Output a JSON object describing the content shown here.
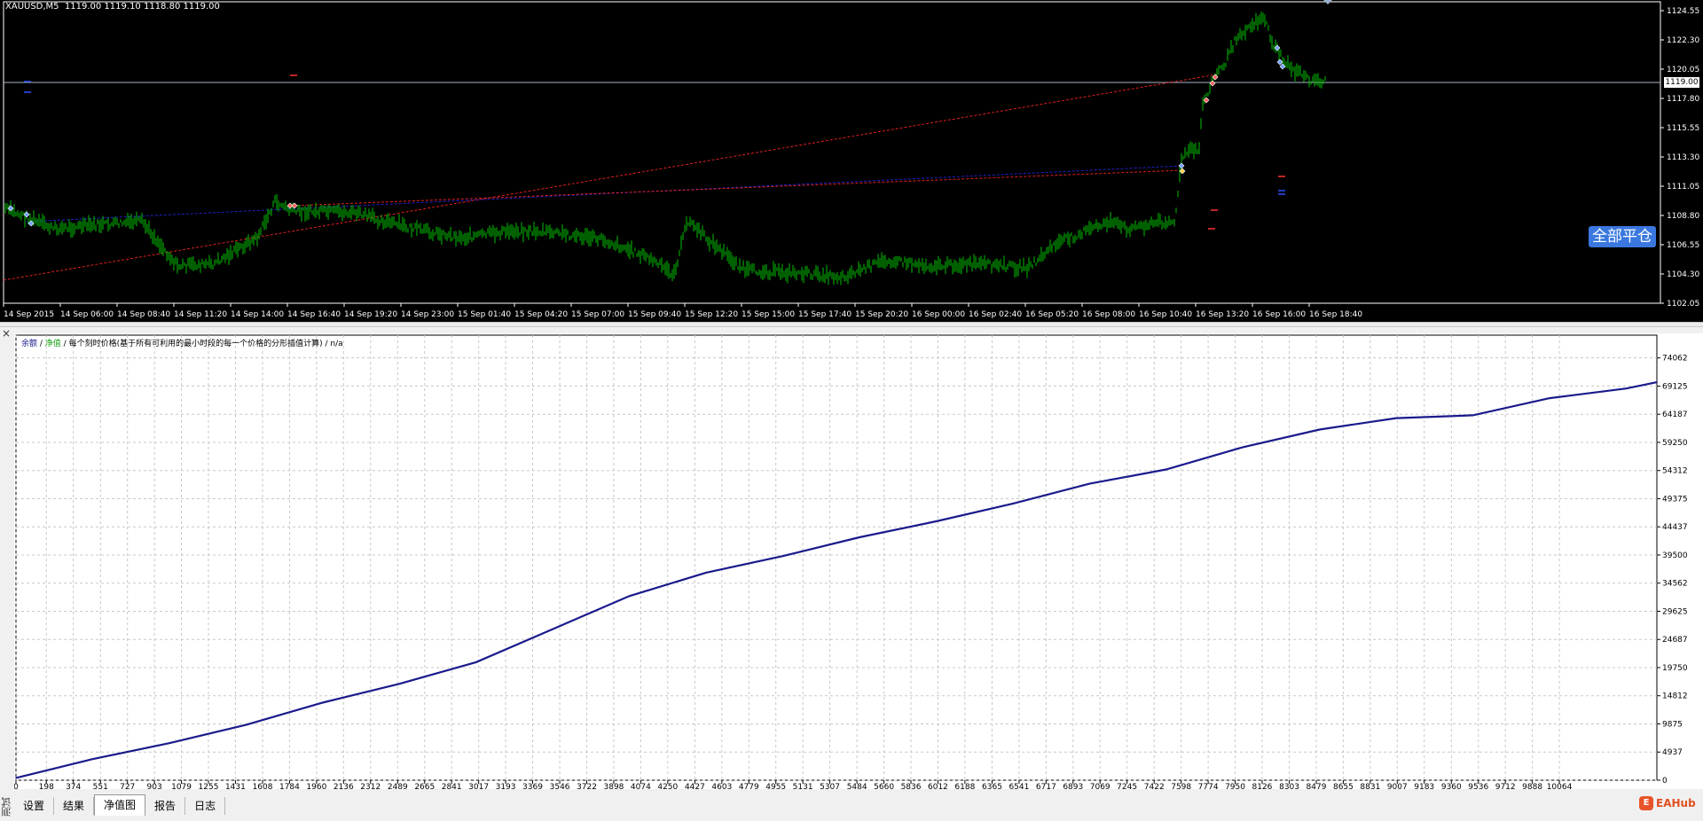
{
  "price_chart": {
    "header": "XAUUSD,M5  1119.00 1119.10 1118.80 1119.00",
    "price_axis": [
      "1124.55",
      "1122.30",
      "1120.05",
      "1117.80",
      "1115.55",
      "1113.30",
      "1111.05",
      "1108.80",
      "1106.55",
      "1104.30",
      "1102.05"
    ],
    "current_price": "1119.00",
    "time_axis": [
      "14 Sep 2015",
      "14 Sep 06:00",
      "14 Sep 08:40",
      "14 Sep 11:20",
      "14 Sep 14:00",
      "14 Sep 16:40",
      "14 Sep 19:20",
      "14 Sep 23:00",
      "15 Sep 01:40",
      "15 Sep 04:20",
      "15 Sep 07:00",
      "15 Sep 09:40",
      "15 Sep 12:20",
      "15 Sep 15:00",
      "15 Sep 17:40",
      "15 Sep 20:20",
      "16 Sep 00:00",
      "16 Sep 02:40",
      "16 Sep 05:20",
      "16 Sep 08:00",
      "16 Sep 10:40",
      "16 Sep 13:20",
      "16 Sep 16:00",
      "16 Sep 18:40"
    ],
    "close_all_label": "全部平仓",
    "colors": {
      "background": "#000000",
      "candles": "#00c000",
      "buy_line": "#2020c8",
      "sell_line": "#e02020"
    }
  },
  "tester_panel": {
    "close_icon": "×",
    "side_label": "测试",
    "legend": {
      "balance": "余额",
      "sep1": " / ",
      "equity": "净值",
      "sep2": " / ",
      "model": "每个刻时价格(基于所有可利用的最小时段的每一个价格的分形插值计算)",
      "sep3": " / ",
      "na": "n/a"
    },
    "tabs": [
      {
        "label": "设置",
        "active": false
      },
      {
        "label": "结果",
        "active": false
      },
      {
        "label": "净值图",
        "active": true
      },
      {
        "label": "报告",
        "active": false
      },
      {
        "label": "日志",
        "active": false
      }
    ],
    "watermark": "EAHub",
    "watermark_logo": "E"
  },
  "chart_data": {
    "type": "line",
    "title": "",
    "x_ticks": [
      "0",
      "198",
      "374",
      "551",
      "727",
      "903",
      "1079",
      "1255",
      "1431",
      "1608",
      "1784",
      "1960",
      "2136",
      "2312",
      "2489",
      "2665",
      "2841",
      "3017",
      "3193",
      "3369",
      "3546",
      "3722",
      "3898",
      "4074",
      "4250",
      "4427",
      "4603",
      "4779",
      "4955",
      "5131",
      "5307",
      "5484",
      "5660",
      "5836",
      "6012",
      "6188",
      "6365",
      "6541",
      "6717",
      "6893",
      "7069",
      "7245",
      "7422",
      "7598",
      "7774",
      "7950",
      "8126",
      "8303",
      "8479",
      "8655",
      "8831",
      "9007",
      "9183",
      "9360",
      "9536",
      "9712",
      "9888",
      "10064"
    ],
    "y_ticks": [
      "74062",
      "69125",
      "64187",
      "59250",
      "54312",
      "49375",
      "44437",
      "39500",
      "34562",
      "29625",
      "24687",
      "19750",
      "14812",
      "9875",
      "4937",
      "0"
    ],
    "xlim": [
      0,
      10700
    ],
    "ylim": [
      0,
      76500
    ],
    "grid": true,
    "series": [
      {
        "name": "余额",
        "color": "#1a1a8c",
        "x": [
          0,
          500,
          1000,
          1500,
          2000,
          2500,
          3000,
          3500,
          4000,
          4500,
          5000,
          5500,
          6000,
          6500,
          7000,
          7500,
          8000,
          8500,
          9000,
          9500,
          10000,
          10500,
          10700
        ],
        "values": [
          400,
          3700,
          6500,
          9700,
          13600,
          16900,
          20700,
          26500,
          32300,
          36400,
          39300,
          42600,
          45400,
          48500,
          52000,
          54500,
          58400,
          61500,
          63500,
          64000,
          67000,
          68700,
          69800
        ]
      }
    ]
  }
}
